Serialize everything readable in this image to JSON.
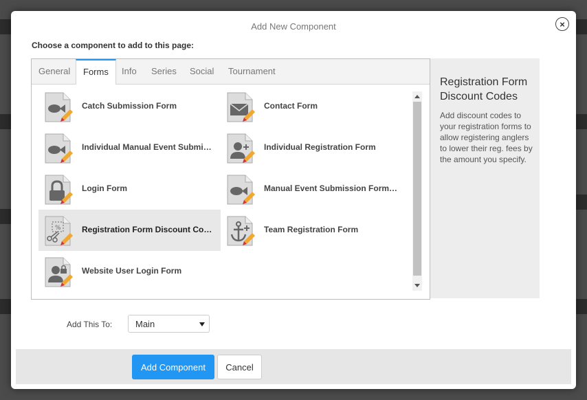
{
  "modal": {
    "title": "Add New Component",
    "close_icon": "×",
    "choose_label": "Choose a component to add to this page:"
  },
  "tabs": [
    {
      "label": "General"
    },
    {
      "label": "Forms",
      "active": true
    },
    {
      "label": "Info"
    },
    {
      "label": "Series"
    },
    {
      "label": "Social"
    },
    {
      "label": "Tournament"
    }
  ],
  "components": [
    {
      "label": "Catch Submission Form",
      "icon": "fish-form-icon"
    },
    {
      "label": "Contact Form",
      "icon": "envelope-form-icon"
    },
    {
      "label": "Individual Manual Event Submission Form",
      "icon": "fish-form-icon"
    },
    {
      "label": "Individual Registration Form",
      "icon": "user-add-form-icon"
    },
    {
      "label": "Login Form",
      "icon": "lock-form-icon"
    },
    {
      "label": "Manual Event Submission Form for Teams",
      "icon": "fish-form-icon"
    },
    {
      "label": "Registration Form Discount Codes",
      "icon": "coupon-scissors-form-icon",
      "selected": true
    },
    {
      "label": "Team Registration Form",
      "icon": "anchor-form-icon"
    },
    {
      "label": "Website User Login Form",
      "icon": "user-lock-form-icon"
    }
  ],
  "info_panel": {
    "title": "Registration Form Discount Codes",
    "description": "Add discount codes to your registration forms to allow registering anglers to lower their reg. fees by the amount you specify."
  },
  "add_to": {
    "label": "Add This To:",
    "selected": "Main"
  },
  "footer": {
    "add_button": "Add Component",
    "cancel_button": "Cancel"
  },
  "colors": {
    "accent": "#2196f3",
    "selected_row": "#e8e8e8",
    "info_panel_bg": "#ededed"
  }
}
